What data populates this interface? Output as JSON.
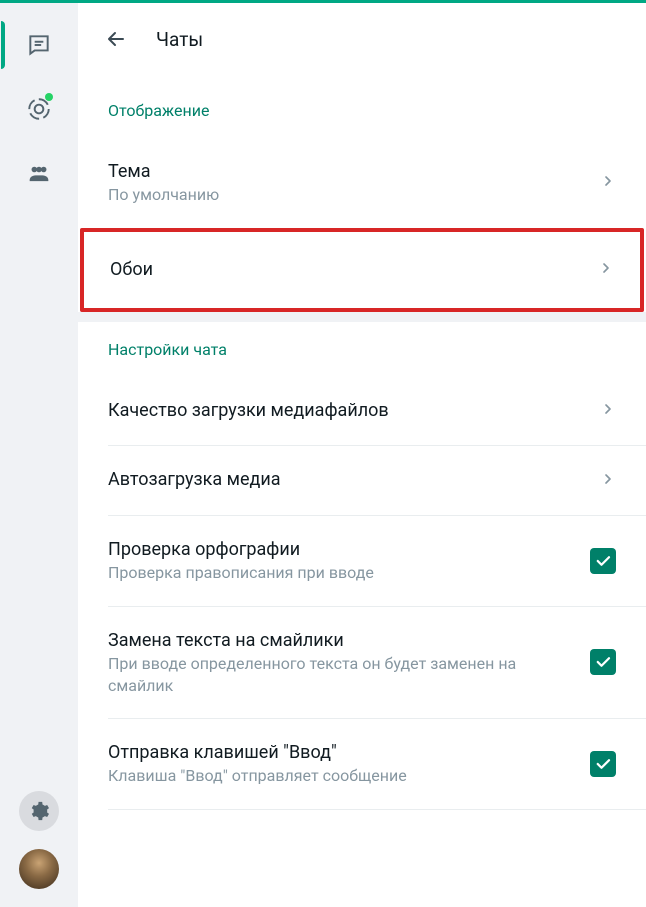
{
  "header": {
    "title": "Чаты"
  },
  "sections": {
    "display": {
      "header": "Отображение",
      "theme": {
        "title": "Тема",
        "sub": "По умолчанию"
      },
      "wallpaper": {
        "title": "Обои"
      }
    },
    "chat_settings": {
      "header": "Настройки чата",
      "media_quality": {
        "title": "Качество загрузки медиафайлов"
      },
      "auto_download": {
        "title": "Автозагрузка медиа"
      },
      "spellcheck": {
        "title": "Проверка орфографии",
        "sub": "Проверка правописания при вводе"
      },
      "emoji_replace": {
        "title": "Замена текста на смайлики",
        "sub": "При вводе определенного текста он будет заменен на смайлик"
      },
      "enter_send": {
        "title": "Отправка клавишей \"Ввод\"",
        "sub": "Клавиша \"Ввод\" отправляет сообщение"
      }
    }
  }
}
